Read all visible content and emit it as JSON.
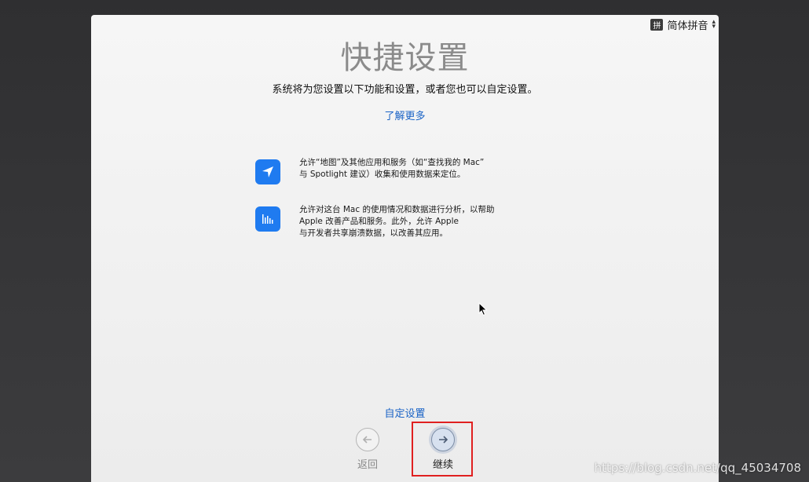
{
  "input_source": {
    "badge": "拼",
    "label": "简体拼音"
  },
  "title": "快捷设置",
  "subtitle": "系统将为您设置以下功能和设置，或者您也可以自定设置。",
  "learn_more": "了解更多",
  "features": [
    {
      "icon": "location-arrow-icon",
      "lines": [
        "允许“地图”及其他应用和服务（如“查找我的 Mac”",
        "与 Spotlight 建议）收集和使用数据来定位。"
      ]
    },
    {
      "icon": "analytics-bars-icon",
      "lines": [
        "允许对这台 Mac 的使用情况和数据进行分析，以帮助",
        "Apple 改善产品和服务。此外，允许 Apple",
        "与开发者共享崩溃数据，以改善其应用。"
      ]
    }
  ],
  "custom_setup": "自定设置",
  "buttons": {
    "back": "返回",
    "continue": "继续"
  },
  "watermark": "https://blog.csdn.net/qq_45034708",
  "colors": {
    "accent": "#1f7bf0",
    "link": "#1a63c6",
    "highlight": "#e02020"
  }
}
